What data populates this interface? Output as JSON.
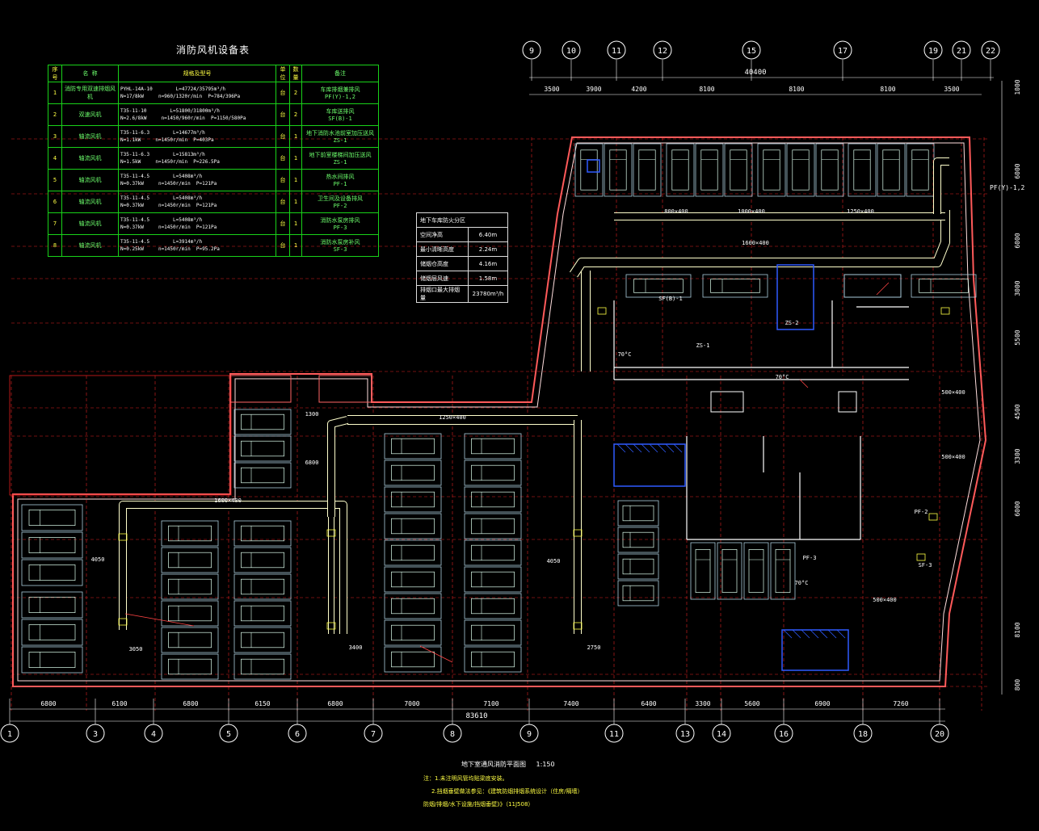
{
  "equipment_table": {
    "title": "消防风机设备表",
    "headers": [
      "序号",
      "名 称",
      "规格及型号",
      "单位",
      "数量",
      "备注"
    ],
    "rows": [
      {
        "no": "1",
        "name": "消防专用双速排烟风机",
        "spec_a": "PYHL-14A-10",
        "spec_b": "N=17/8kW",
        "spec_c": "L=47724/35795m³/h",
        "spec_d": "n=960/1320r/min  P=784/396Pa",
        "unit": "台",
        "qty": "2",
        "remark": "车库排烟兼排风",
        "remark2": "PF(Y)-1,2"
      },
      {
        "no": "2",
        "name": "双速风机",
        "spec_a": "T35-11-10",
        "spec_b": "N=2.6/8kW",
        "spec_c": "L=51800/31800m³/h",
        "spec_d": "n=1450/960r/min  P=1150/580Pa",
        "unit": "台",
        "qty": "2",
        "remark": "车库送排风",
        "remark2": "SF(B)-1"
      },
      {
        "no": "3",
        "name": "轴流风机",
        "spec_a": "T35-11-6.3",
        "spec_b": "N=1.1kW",
        "spec_c": "L=14677m³/h",
        "spec_d": "n=1450r/min  P=403Pa",
        "unit": "台",
        "qty": "1",
        "remark": "地下消防水池前室加压送风",
        "remark2": "ZS-1"
      },
      {
        "no": "4",
        "name": "轴流风机",
        "spec_a": "T35-11-6.3",
        "spec_b": "N=1.5kW",
        "spec_c": "L=15813m³/h",
        "spec_d": "n=1450r/min  P=226.5Pa",
        "unit": "台",
        "qty": "1",
        "remark": "地下前室楼梯间加压送风",
        "remark2": "ZS-1"
      },
      {
        "no": "5",
        "name": "轴流风机",
        "spec_a": "T35-11-4.5",
        "spec_b": "N=0.37kW",
        "spec_c": "L=5408m³/h",
        "spec_d": "n=1450r/min  P=121Pa",
        "unit": "台",
        "qty": "1",
        "remark": "热水间排风",
        "remark2": "PF-1"
      },
      {
        "no": "6",
        "name": "轴流风机",
        "spec_a": "T35-11-4.5",
        "spec_b": "N=0.37kW",
        "spec_c": "L=5408m³/h",
        "spec_d": "n=1450r/min  P=121Pa",
        "unit": "台",
        "qty": "1",
        "remark": "卫生间及设备排风",
        "remark2": "PF-2"
      },
      {
        "no": "7",
        "name": "轴流风机",
        "spec_a": "T35-11-4.5",
        "spec_b": "N=0.37kW",
        "spec_c": "L=5408m³/h",
        "spec_d": "n=1450r/min  P=121Pa",
        "unit": "台",
        "qty": "1",
        "remark": "消防水泵房排风",
        "remark2": "PF-3"
      },
      {
        "no": "8",
        "name": "轴流风机",
        "spec_a": "T35-11-4.5",
        "spec_b": "N=0.25kW",
        "spec_c": "L=3914m³/h",
        "spec_d": "n=1450r/min  P=95.2Pa",
        "unit": "台",
        "qty": "1",
        "remark": "消防水泵房补风",
        "remark2": "SF-3"
      }
    ]
  },
  "params_table": {
    "title": "地下车库防火分区",
    "rows": [
      {
        "k": "空间净高",
        "v": "6.40m"
      },
      {
        "k": "最小清晰高度",
        "v": "2.24m"
      },
      {
        "k": "储烟仓高度",
        "v": "4.16m"
      },
      {
        "k": "储烟层风速",
        "v": "1.58m"
      },
      {
        "k": "排烟口最大排烟量",
        "v": "23780m³/h"
      }
    ]
  },
  "top_axes": [
    "9",
    "10",
    "11",
    "12",
    "15",
    "17",
    "19",
    "21",
    "22"
  ],
  "top_dims": [
    "3500",
    "3900",
    "4200",
    "8100",
    "8100",
    "8100",
    "3500"
  ],
  "top_total": "40400",
  "bottom_axes": [
    "1",
    "3",
    "4",
    "5",
    "6",
    "7",
    "8",
    "9",
    "11",
    "13",
    "14",
    "16",
    "18",
    "20"
  ],
  "bottom_dims": [
    "6800",
    "6100",
    "6800",
    "6150",
    "6800",
    "7000",
    "7100",
    "7400",
    "6400",
    "3300",
    "5600",
    "6900",
    "7260"
  ],
  "bottom_total": "83610",
  "right_dims": [
    "1000",
    "6000",
    "6000",
    "3000",
    "5500",
    "4500",
    "3300",
    "6000",
    "8100",
    "800"
  ],
  "labels": {
    "pf_y12": "PF(Y)-1,2",
    "sf_b1": "SF(B)-1",
    "zs1": "ZS-1",
    "zs2": "ZS-2",
    "pf2": "PF-2",
    "pf3": "PF-3",
    "sf3": "SF-3",
    "duct_1600x400": "1600×400",
    "duct_1250x400": "1250×400",
    "duct_1000x400": "1000×400",
    "duct_800x400": "800×400",
    "duct_500x400": "500×400",
    "deg70": "70°C",
    "d2750": "2750",
    "d3050": "3050",
    "d3400": "3400",
    "d4050": "4050",
    "d1300": "1300",
    "d6800": "6800"
  },
  "plan_title": "地下室通风消防平面图",
  "plan_scale": "1:150",
  "notes": [
    "注：1.未注明风管均贴梁底安装。",
    "2.挡烟垂壁做法参见：《建筑防烟排烟系统设计（住房/隔墙）",
    "防烟/排烟/水下设施/挡烟垂壁》》（11J508）"
  ],
  "colors": {
    "duct": "#ffffcc",
    "wall": "#ff5a5a",
    "grid": "#e02020",
    "car": "#aaccdd",
    "table": "#19d219",
    "blue": "#2f5bff",
    "text_yellow": "#ffff44",
    "dim_white": "#ffffff"
  }
}
